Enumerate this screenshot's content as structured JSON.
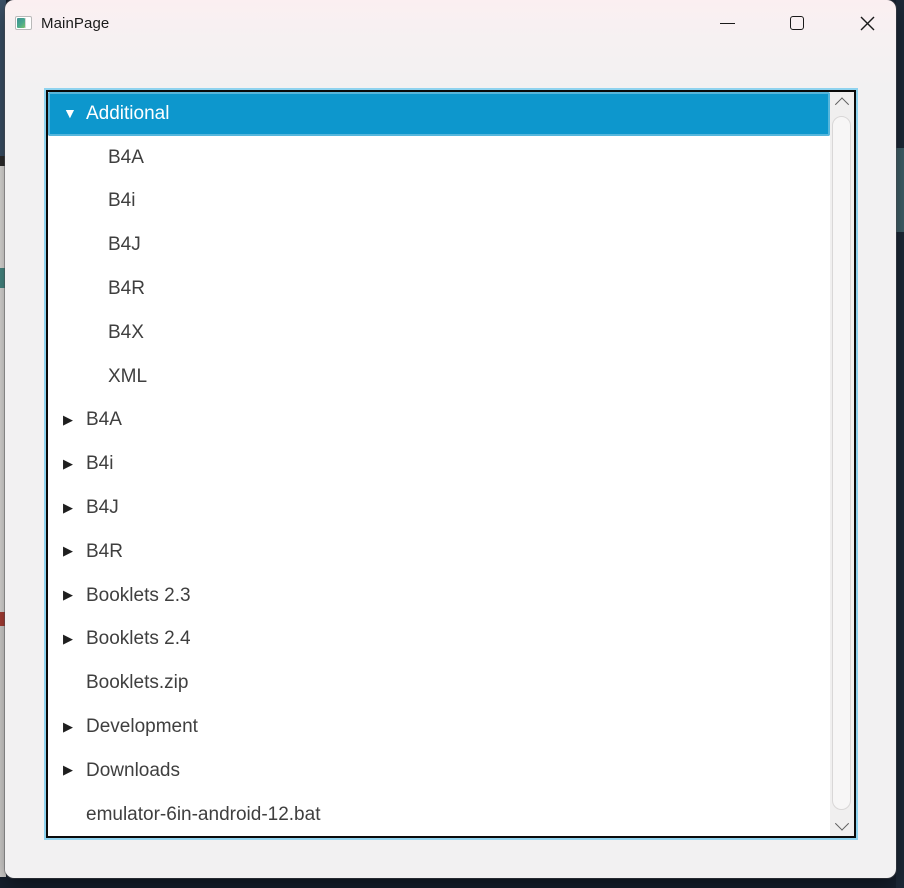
{
  "window": {
    "title": "MainPage"
  },
  "tree": {
    "items": [
      {
        "label": "Additional",
        "level": 0,
        "state": "expanded",
        "selected": true
      },
      {
        "label": "B4A",
        "level": 1,
        "state": "leaf",
        "selected": false
      },
      {
        "label": "B4i",
        "level": 1,
        "state": "leaf",
        "selected": false
      },
      {
        "label": "B4J",
        "level": 1,
        "state": "leaf",
        "selected": false
      },
      {
        "label": "B4R",
        "level": 1,
        "state": "leaf",
        "selected": false
      },
      {
        "label": "B4X",
        "level": 1,
        "state": "leaf",
        "selected": false
      },
      {
        "label": "XML",
        "level": 1,
        "state": "leaf",
        "selected": false
      },
      {
        "label": "B4A",
        "level": 0,
        "state": "collapsed",
        "selected": false
      },
      {
        "label": "B4i",
        "level": 0,
        "state": "collapsed",
        "selected": false
      },
      {
        "label": "B4J",
        "level": 0,
        "state": "collapsed",
        "selected": false
      },
      {
        "label": "B4R",
        "level": 0,
        "state": "collapsed",
        "selected": false
      },
      {
        "label": "Booklets 2.3",
        "level": 0,
        "state": "collapsed",
        "selected": false
      },
      {
        "label": "Booklets 2.4",
        "level": 0,
        "state": "collapsed",
        "selected": false
      },
      {
        "label": "Booklets.zip",
        "level": 0,
        "state": "leaf",
        "selected": false
      },
      {
        "label": "Development",
        "level": 0,
        "state": "collapsed",
        "selected": false
      },
      {
        "label": "Downloads",
        "level": 0,
        "state": "collapsed",
        "selected": false
      },
      {
        "label": "emulator-6in-android-12.bat",
        "level": 0,
        "state": "leaf",
        "selected": false
      }
    ],
    "expanded_glyph": "▼",
    "collapsed_glyph": "▶"
  },
  "colors": {
    "selection": "#0d97cd",
    "focus_ring": "#8fd3ef",
    "item_text": "#3f3f3f",
    "selected_text": "#ffffff"
  }
}
